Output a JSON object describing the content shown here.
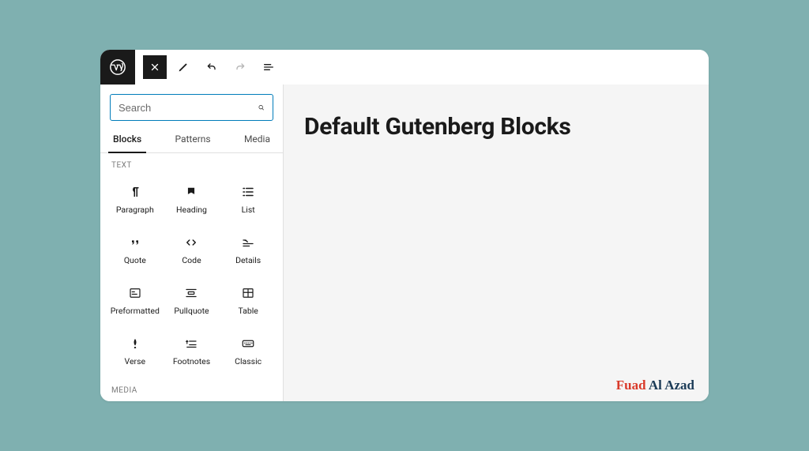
{
  "accentColor": "#007cba",
  "search": {
    "placeholder": "Search"
  },
  "tabs": {
    "blocks": "Blocks",
    "patterns": "Patterns",
    "media": "Media"
  },
  "categories": {
    "text": "TEXT",
    "media": "MEDIA"
  },
  "blocks": [
    {
      "label": "Paragraph"
    },
    {
      "label": "Heading"
    },
    {
      "label": "List"
    },
    {
      "label": "Quote"
    },
    {
      "label": "Code"
    },
    {
      "label": "Details"
    },
    {
      "label": "Preformatted"
    },
    {
      "label": "Pullquote"
    },
    {
      "label": "Table"
    },
    {
      "label": "Verse"
    },
    {
      "label": "Footnotes"
    },
    {
      "label": "Classic"
    }
  ],
  "canvas": {
    "title": "Default Gutenberg Blocks"
  },
  "watermark": {
    "first": "Fuad",
    "last": "Al Azad"
  }
}
